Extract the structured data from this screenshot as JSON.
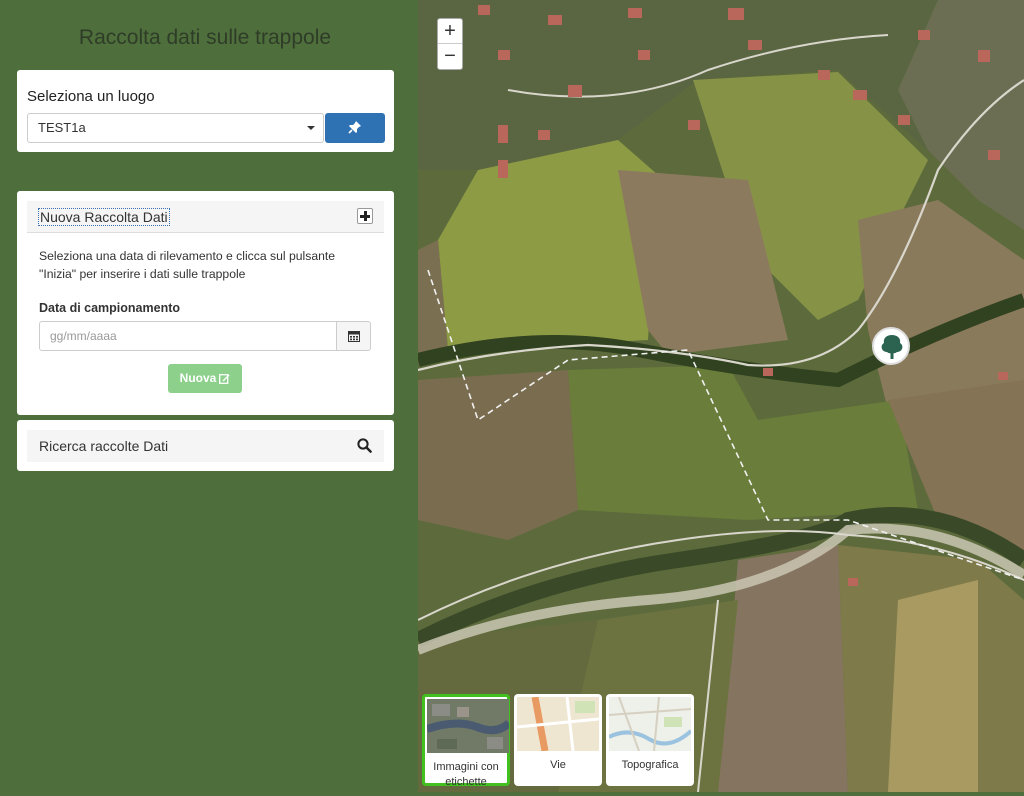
{
  "app": {
    "title": "Raccolta dati sulle trappole"
  },
  "place": {
    "label": "Seleziona un luogo",
    "selected": "TEST1a",
    "pin_icon": "pin-icon"
  },
  "new_collection": {
    "title": "Nuova Raccolta Dati",
    "help": "Seleziona una data di rilevamento e clicca sul pulsante \"Inizia\" per inserire i dati sulle trappole",
    "date_label": "Data di campionamento",
    "date_placeholder": "gg/mm/aaaa",
    "date_value": "",
    "new_button": "Nuova"
  },
  "search_collections": {
    "title": "Ricerca raccolte Dati"
  },
  "map": {
    "zoom_in": "+",
    "zoom_out": "−",
    "basemaps": [
      "Immagini con etichette",
      "Vie",
      "Topografica"
    ],
    "selected_basemap": "Immagini con etichette",
    "marker_icon": "tree-icon"
  },
  "colors": {
    "sidebar_bg": "#4e6e3c",
    "primary": "#2f72b4",
    "success_disabled": "#8cd08c",
    "basemap_selected": "#42c01f"
  }
}
